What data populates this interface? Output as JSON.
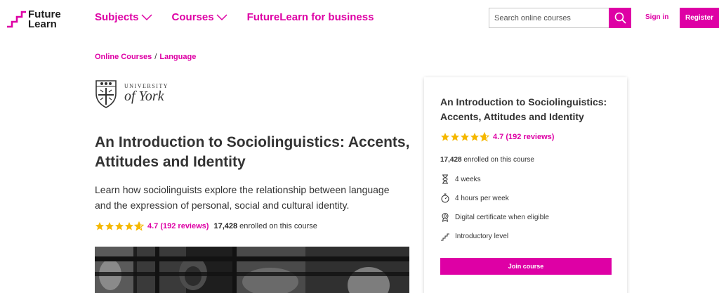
{
  "header": {
    "logo_line1": "Future",
    "logo_line2": "Learn",
    "nav": {
      "subjects": "Subjects",
      "courses": "Courses",
      "business": "FutureLearn for business"
    },
    "search_placeholder": "Search online courses",
    "signin": "Sign in",
    "register": "Register"
  },
  "breadcrumb": {
    "item1": "Online Courses",
    "separator": "/",
    "item2": "Language"
  },
  "university": {
    "line1": "UNIVERSITY",
    "line2": "of York"
  },
  "course": {
    "title": "An Introduction to Sociolinguistics: Accents, Attitudes and Identity",
    "description": "Learn how sociolinguists explore the relationship between language and the expression of personal, social and cultural identity.",
    "rating_text": "4.7 (192 reviews)",
    "rating_value": 4.7,
    "enrolled_count": "17,428",
    "enrolled_suffix": "enrolled on this course"
  },
  "card": {
    "title": "An Introduction to Sociolinguistics: Accents, Attitudes and Identity",
    "rating_text": "4.7 (192 reviews)",
    "enrolled_count": "17,428",
    "enrolled_suffix": "enrolled on this course",
    "features": {
      "duration": "4 weeks",
      "hours": "4 hours per week",
      "certificate": "Digital certificate when eligible",
      "level": "Introductory level"
    },
    "join_label": "Join course"
  },
  "icons": {
    "duration": "hourglass-icon",
    "hours": "stopwatch-icon",
    "certificate": "certificate-icon",
    "level": "steps-icon"
  },
  "colors": {
    "brand": "#de00a5",
    "star": "#f5b800"
  }
}
